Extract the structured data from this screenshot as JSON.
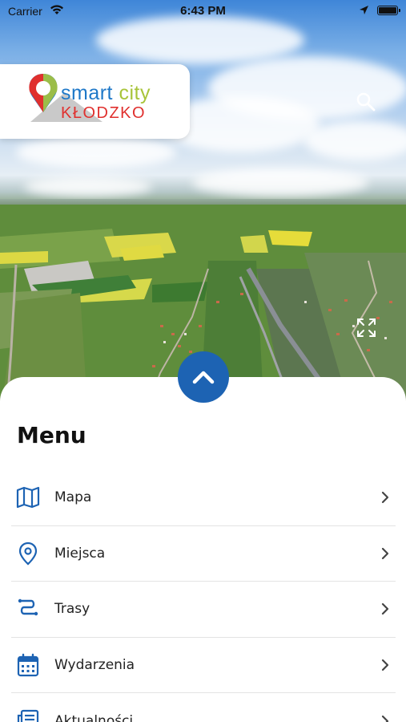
{
  "status_bar": {
    "carrier": "Carrier",
    "time": "6:43 PM"
  },
  "logo": {
    "word_smart": "smart",
    "word_city": "city",
    "word_town": "KŁODZKO"
  },
  "menu": {
    "title": "Menu",
    "items": [
      {
        "label": "Mapa",
        "icon": "map-icon"
      },
      {
        "label": "Miejsca",
        "icon": "location-pin-icon"
      },
      {
        "label": "Trasy",
        "icon": "route-icon"
      },
      {
        "label": "Wydarzenia",
        "icon": "calendar-icon"
      },
      {
        "label": "Aktualności",
        "icon": "news-icon"
      }
    ]
  },
  "colors": {
    "brand_blue": "#1d63b3",
    "logo_blue": "#1e78c8",
    "logo_green": "#a8c43a",
    "logo_red": "#e0302e"
  }
}
